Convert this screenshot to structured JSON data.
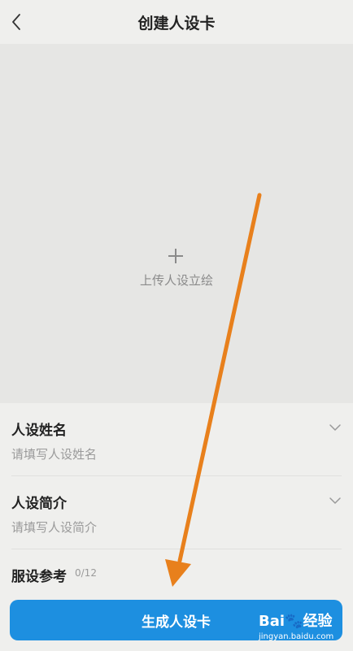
{
  "header": {
    "title": "创建人设卡",
    "back_icon": "chevron-left-icon"
  },
  "upload": {
    "label": "上传人设立绘",
    "icon": "plus-icon"
  },
  "form": {
    "name_field": {
      "label": "人设姓名",
      "placeholder": "请填写人设姓名",
      "value": ""
    },
    "intro_field": {
      "label": "人设简介",
      "placeholder": "请填写人设简介",
      "value": ""
    },
    "costume_ref": {
      "label": "服设参考",
      "counter": "0/12"
    }
  },
  "actions": {
    "generate_label": "生成人设卡"
  },
  "watermark": {
    "brand": "Bai",
    "brand_suffix": "经验",
    "url": "jingyan.baidu.com"
  },
  "colors": {
    "primary": "#1d8fe0",
    "background": "#efefed",
    "upload_bg": "#e6e6e4",
    "annotation_arrow": "#e8801c"
  }
}
